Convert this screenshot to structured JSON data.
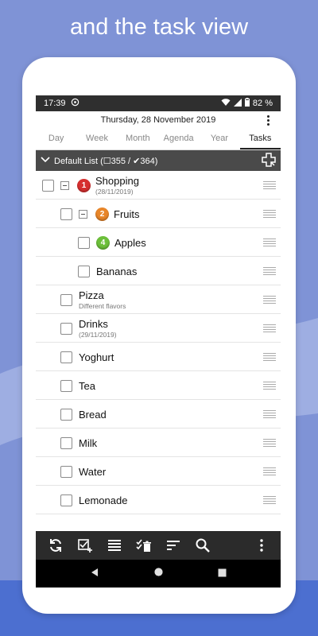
{
  "headline": "and the task view",
  "status": {
    "time": "17:39",
    "battery": "82 %"
  },
  "date_header": "Thursday, 28 November 2019",
  "tabs": [
    {
      "label": "Day",
      "active": false
    },
    {
      "label": "Week",
      "active": false
    },
    {
      "label": "Month",
      "active": false
    },
    {
      "label": "Agenda",
      "active": false
    },
    {
      "label": "Year",
      "active": false
    },
    {
      "label": "Tasks",
      "active": true
    }
  ],
  "list_header": {
    "title": "Default List (☐355 / ✔364)",
    "add_icon": "add-list-icon"
  },
  "tasks": [
    {
      "label": "Shopping",
      "sub": "(28/11/2019)",
      "indent": 0,
      "collapsible": true,
      "priority": "1",
      "priority_color": "#d62f2f"
    },
    {
      "label": "Fruits",
      "sub": "",
      "indent": 1,
      "collapsible": true,
      "priority": "2",
      "priority_color": "#e8862a"
    },
    {
      "label": "Apples",
      "sub": "",
      "indent": 2,
      "collapsible": false,
      "priority": "4",
      "priority_color": "#6cbf3a"
    },
    {
      "label": "Bananas",
      "sub": "",
      "indent": 2,
      "collapsible": false,
      "priority": "",
      "priority_color": ""
    },
    {
      "label": "Pizza",
      "sub": "Different flavors",
      "indent": 1,
      "collapsible": false,
      "priority": "",
      "priority_color": ""
    },
    {
      "label": "Drinks",
      "sub": "(29/11/2019)",
      "indent": 1,
      "collapsible": false,
      "priority": "",
      "priority_color": ""
    },
    {
      "label": "Yoghurt",
      "sub": "",
      "indent": 1,
      "collapsible": false,
      "priority": "",
      "priority_color": ""
    },
    {
      "label": "Tea",
      "sub": "",
      "indent": 1,
      "collapsible": false,
      "priority": "",
      "priority_color": ""
    },
    {
      "label": "Bread",
      "sub": "",
      "indent": 1,
      "collapsible": false,
      "priority": "",
      "priority_color": ""
    },
    {
      "label": "Milk",
      "sub": "",
      "indent": 1,
      "collapsible": false,
      "priority": "",
      "priority_color": ""
    },
    {
      "label": "Water",
      "sub": "",
      "indent": 1,
      "collapsible": false,
      "priority": "",
      "priority_color": ""
    },
    {
      "label": "Lemonade",
      "sub": "",
      "indent": 1,
      "collapsible": false,
      "priority": "",
      "priority_color": ""
    }
  ],
  "toolbar": [
    "sync-icon",
    "add-task-icon",
    "list-view-icon",
    "clear-done-icon",
    "sort-icon",
    "search-icon",
    "more-icon"
  ],
  "colors": {
    "page_bg": "#7f93d6",
    "list_header_bg": "#4a4a4a",
    "toolbar_bg": "#2b2b2b"
  }
}
